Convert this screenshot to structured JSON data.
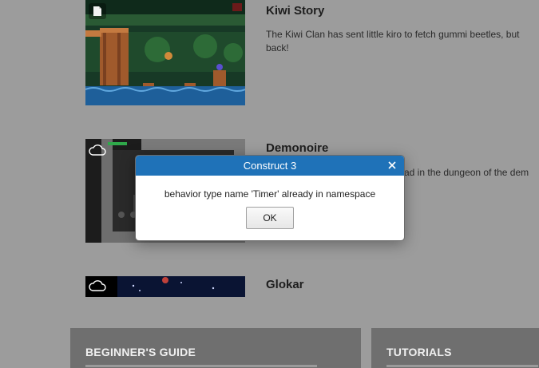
{
  "examples": [
    {
      "title": "Kiwi Story",
      "description": "The Kiwi Clan has sent little kiro to fetch gummi beetles, but",
      "description_cont": "back!",
      "badge_icon": "document-icon"
    },
    {
      "title": "Demonoire",
      "description": "ad in the dungeon of the dem",
      "badge_icon": "cloud-icon"
    },
    {
      "title": "Glokar",
      "badge_icon": "cloud-icon"
    }
  ],
  "cards": [
    {
      "title": "BEGINNER'S GUIDE"
    },
    {
      "title": "TUTORIALS"
    }
  ],
  "dialog": {
    "title": "Construct 3",
    "message": "behavior type name 'Timer' already in namespace",
    "ok_label": "OK",
    "header_color": "#1f72b8"
  }
}
